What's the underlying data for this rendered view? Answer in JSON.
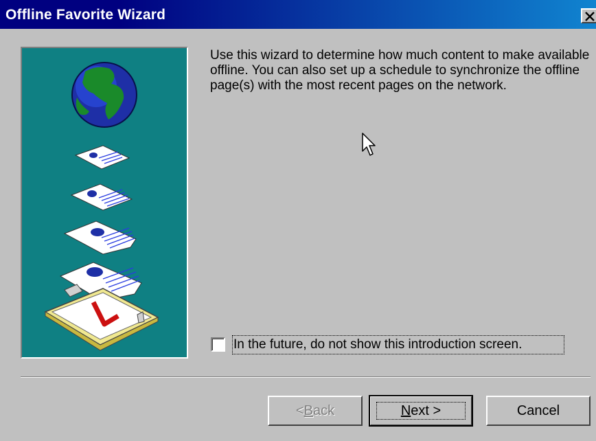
{
  "window": {
    "title": "Offline Favorite Wizard",
    "close_label": "×"
  },
  "content": {
    "intro": "Use this wizard to determine how much content to make available offline. You can also set up a schedule to synchronize the offline page(s) with the most recent pages on the network.",
    "checkbox_label": "In the future, do not show this introduction screen.",
    "checkbox_checked": false
  },
  "buttons": {
    "back_pre": "< ",
    "back_mnemonic": "B",
    "back_post": "ack",
    "back_enabled": false,
    "next_mnemonic": "N",
    "next_post": "ext >",
    "cancel": "Cancel"
  },
  "icons": {
    "illustration": "globe-and-offline-pages-icon",
    "cursor": "mouse-pointer-icon",
    "close": "close-icon"
  },
  "colors": {
    "titlebar_start": "#000080",
    "titlebar_end": "#1084d0",
    "illustration_bg": "#0f8083",
    "face": "#c0c0c0"
  }
}
